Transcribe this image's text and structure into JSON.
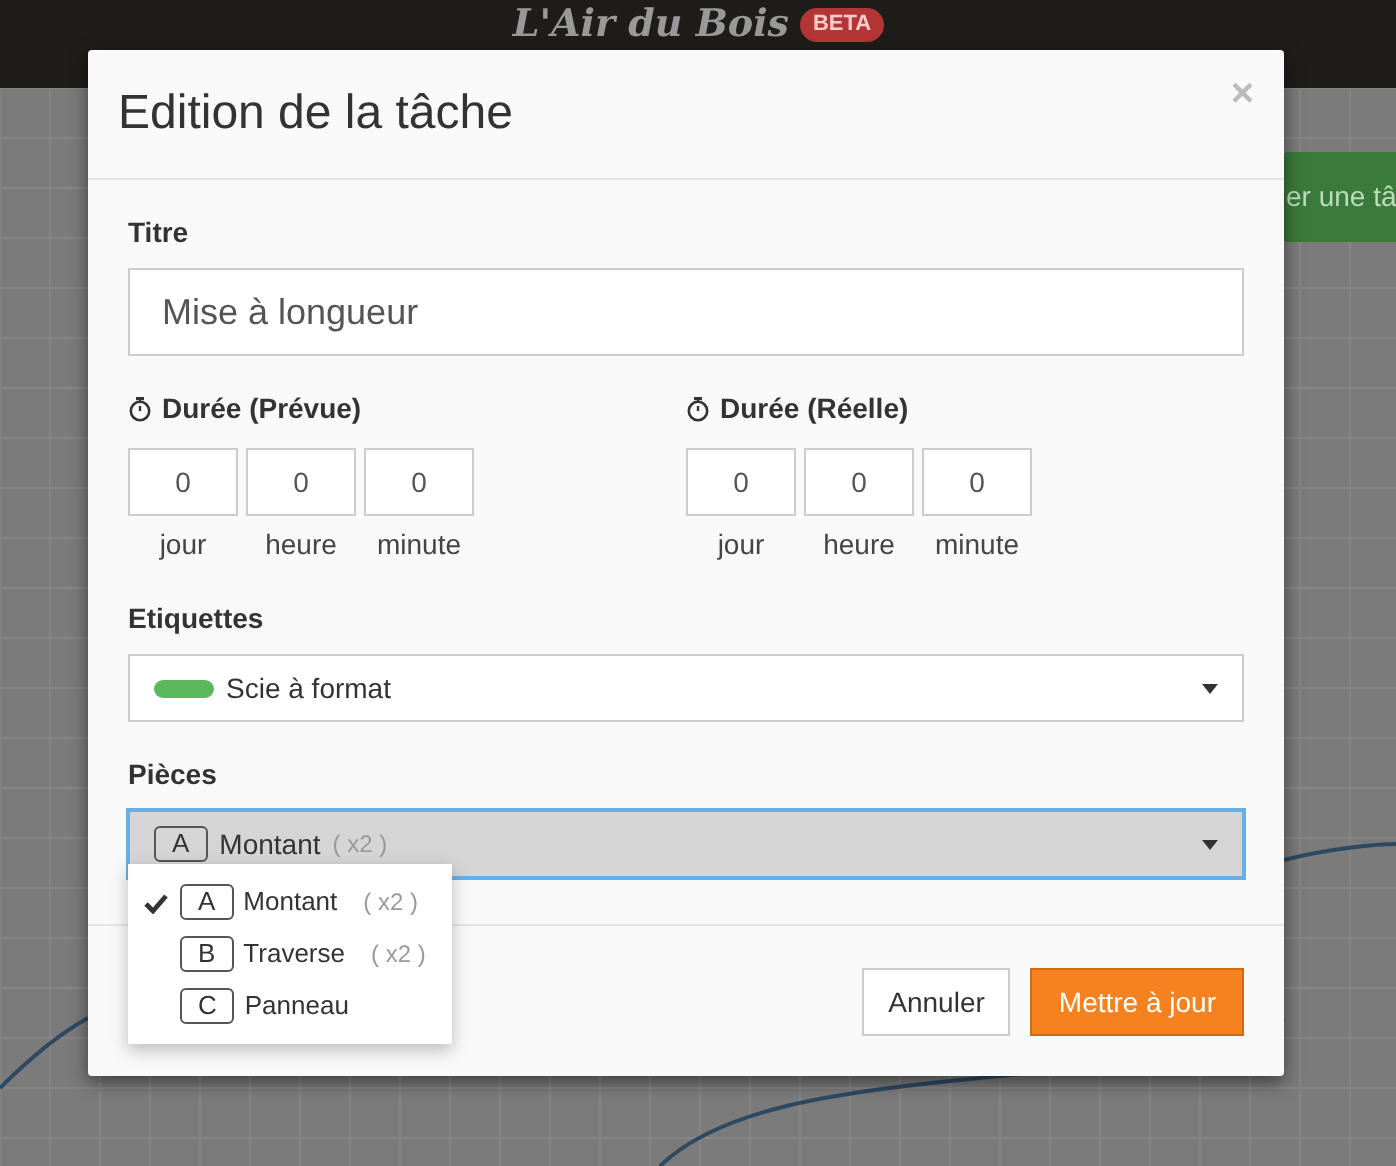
{
  "header": {
    "logo": "L'Air du Bois",
    "badge": "BETA"
  },
  "background_button": {
    "label": "er une tâ"
  },
  "modal": {
    "title": "Edition de la tâche",
    "close": "×",
    "title_field": {
      "label": "Titre",
      "value": "Mise à longueur"
    },
    "durations": [
      {
        "label": "Durée (Prévue)",
        "fields": [
          {
            "value": "0",
            "unit": "jour"
          },
          {
            "value": "0",
            "unit": "heure"
          },
          {
            "value": "0",
            "unit": "minute"
          }
        ]
      },
      {
        "label": "Durée (Réelle)",
        "fields": [
          {
            "value": "0",
            "unit": "jour"
          },
          {
            "value": "0",
            "unit": "heure"
          },
          {
            "value": "0",
            "unit": "minute"
          }
        ]
      }
    ],
    "tags": {
      "label": "Etiquettes",
      "value": {
        "text": "Scie à format",
        "color": "#5cb85c"
      }
    },
    "pieces": {
      "label": "Pièces",
      "value": {
        "letter": "A",
        "name": "Montant",
        "quantity": "( x2 )"
      },
      "options": [
        {
          "letter": "A",
          "name": "Montant",
          "quantity": "( x2 )",
          "selected": true
        },
        {
          "letter": "B",
          "name": "Traverse",
          "quantity": "( x2 )",
          "selected": false
        },
        {
          "letter": "C",
          "name": "Panneau",
          "selected": false
        }
      ]
    },
    "buttons": [
      {
        "label": "Annuler",
        "kind": "secondary"
      },
      {
        "label": "Mettre à jour",
        "kind": "primary"
      }
    ]
  }
}
